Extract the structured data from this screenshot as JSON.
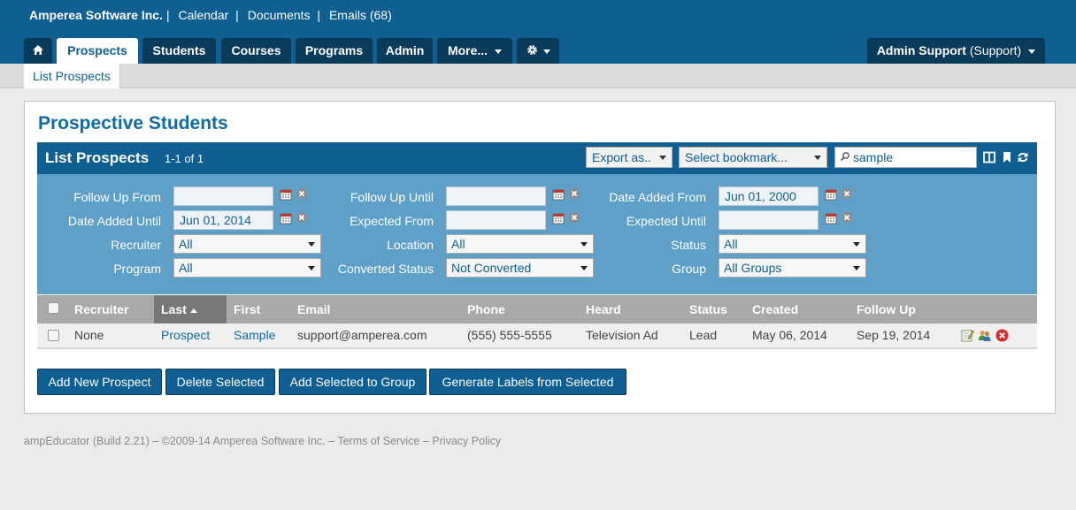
{
  "topbar": {
    "brand": "Amperea Software Inc.",
    "links": [
      "Calendar",
      "Documents",
      "Emails (68)"
    ]
  },
  "nav": {
    "home_icon": "home-icon",
    "tabs": [
      "Prospects",
      "Students",
      "Courses",
      "Programs",
      "Admin",
      "More..."
    ],
    "settings_icon": "gear-icon",
    "user_name": "Admin Support",
    "user_role": "(Support)"
  },
  "subnav": {
    "active": "List Prospects"
  },
  "page": {
    "title": "Prospective Students"
  },
  "list": {
    "title": "List Prospects",
    "count": "1-1 of 1",
    "export_label": "Export as..",
    "bookmark_label": "Select bookmark...",
    "search_value": "sample"
  },
  "filters": {
    "follow_up_from": {
      "label": "Follow Up From",
      "value": ""
    },
    "follow_up_until": {
      "label": "Follow Up Until",
      "value": ""
    },
    "date_added_from": {
      "label": "Date Added From",
      "value": "Jun 01, 2000"
    },
    "date_added_until": {
      "label": "Date Added Until",
      "value": "Jun 01, 2014"
    },
    "expected_from": {
      "label": "Expected From",
      "value": ""
    },
    "expected_until": {
      "label": "Expected Until",
      "value": ""
    },
    "recruiter": {
      "label": "Recruiter",
      "value": "All"
    },
    "location": {
      "label": "Location",
      "value": "All"
    },
    "status": {
      "label": "Status",
      "value": "All"
    },
    "program": {
      "label": "Program",
      "value": "All"
    },
    "converted_status": {
      "label": "Converted Status",
      "value": "Not Converted"
    },
    "group": {
      "label": "Group",
      "value": "All Groups"
    }
  },
  "table": {
    "headers": [
      "Recruiter",
      "Last",
      "First",
      "Email",
      "Phone",
      "Heard",
      "Status",
      "Created",
      "Follow Up"
    ],
    "rows": [
      {
        "recruiter": "None",
        "last": "Prospect",
        "first": "Sample",
        "email": "support@amperea.com",
        "phone": "(555) 555-5555",
        "heard": "Television Ad",
        "status": "Lead",
        "created": "May 06, 2014",
        "follow_up": "Sep 19, 2014"
      }
    ]
  },
  "buttons": {
    "add": "Add New Prospect",
    "delete": "Delete Selected",
    "add_group": "Add Selected to Group",
    "labels": "Generate Labels from Selected"
  },
  "footer": {
    "text": "ampEducator (Build 2.21) – ©2009-14 Amperea Software Inc. – ",
    "terms": "Terms of Service",
    "dash": " – ",
    "privacy": "Privacy Policy"
  },
  "colors": {
    "primary": "#0f5f92",
    "dark_tab": "#0a3b5a",
    "filter_bg": "#5ea0c8",
    "table_header": "#a9a9a9"
  }
}
